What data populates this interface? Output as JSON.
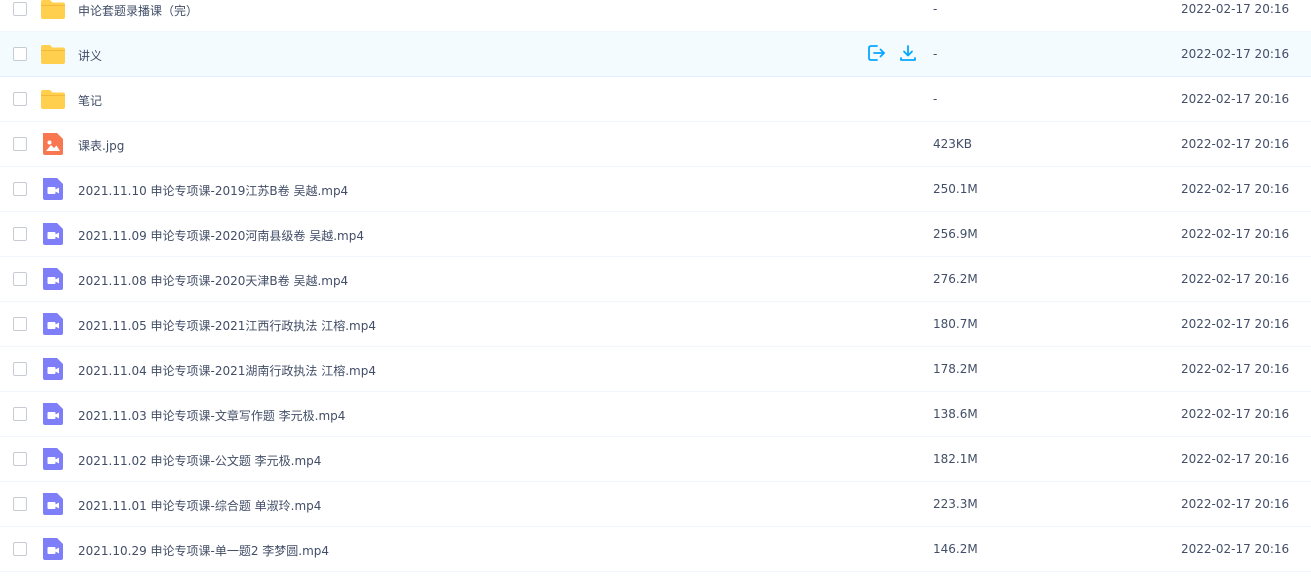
{
  "colors": {
    "accent": "#06a7ff",
    "folder": "#ffcf4d",
    "image": "#f97750",
    "video": "#7e7ff8",
    "text": "#424e67"
  },
  "row_actions": [
    {
      "icon": "share-icon"
    },
    {
      "icon": "download-icon"
    }
  ],
  "files": [
    {
      "name": "申论套题录播课（完）",
      "size": "-",
      "modified": "2022-02-17 20:16",
      "type": "folder"
    },
    {
      "name": "讲义",
      "size": "-",
      "modified": "2022-02-17 20:16",
      "type": "folder",
      "hovered": true
    },
    {
      "name": "笔记",
      "size": "-",
      "modified": "2022-02-17 20:16",
      "type": "folder"
    },
    {
      "name": "课表.jpg",
      "size": "423KB",
      "modified": "2022-02-17 20:16",
      "type": "image"
    },
    {
      "name": "2021.11.10 申论专项课-2019江苏B卷 吴越.mp4",
      "size": "250.1M",
      "modified": "2022-02-17 20:16",
      "type": "video"
    },
    {
      "name": "2021.11.09 申论专项课-2020河南县级卷 吴越.mp4",
      "size": "256.9M",
      "modified": "2022-02-17 20:16",
      "type": "video"
    },
    {
      "name": "2021.11.08 申论专项课-2020天津B卷 吴越.mp4",
      "size": "276.2M",
      "modified": "2022-02-17 20:16",
      "type": "video"
    },
    {
      "name": "2021.11.05 申论专项课-2021江西行政执法 江榕.mp4",
      "size": "180.7M",
      "modified": "2022-02-17 20:16",
      "type": "video"
    },
    {
      "name": "2021.11.04 申论专项课-2021湖南行政执法 江榕.mp4",
      "size": "178.2M",
      "modified": "2022-02-17 20:16",
      "type": "video"
    },
    {
      "name": "2021.11.03 申论专项课-文章写作题 李元极.mp4",
      "size": "138.6M",
      "modified": "2022-02-17 20:16",
      "type": "video"
    },
    {
      "name": "2021.11.02 申论专项课-公文题 李元极.mp4",
      "size": "182.1M",
      "modified": "2022-02-17 20:16",
      "type": "video"
    },
    {
      "name": "2021.11.01 申论专项课-综合题 单淑玲.mp4",
      "size": "223.3M",
      "modified": "2022-02-17 20:16",
      "type": "video"
    },
    {
      "name": "2021.10.29 申论专项课-单一题2 李梦圆.mp4",
      "size": "146.2M",
      "modified": "2022-02-17 20:16",
      "type": "video"
    }
  ]
}
